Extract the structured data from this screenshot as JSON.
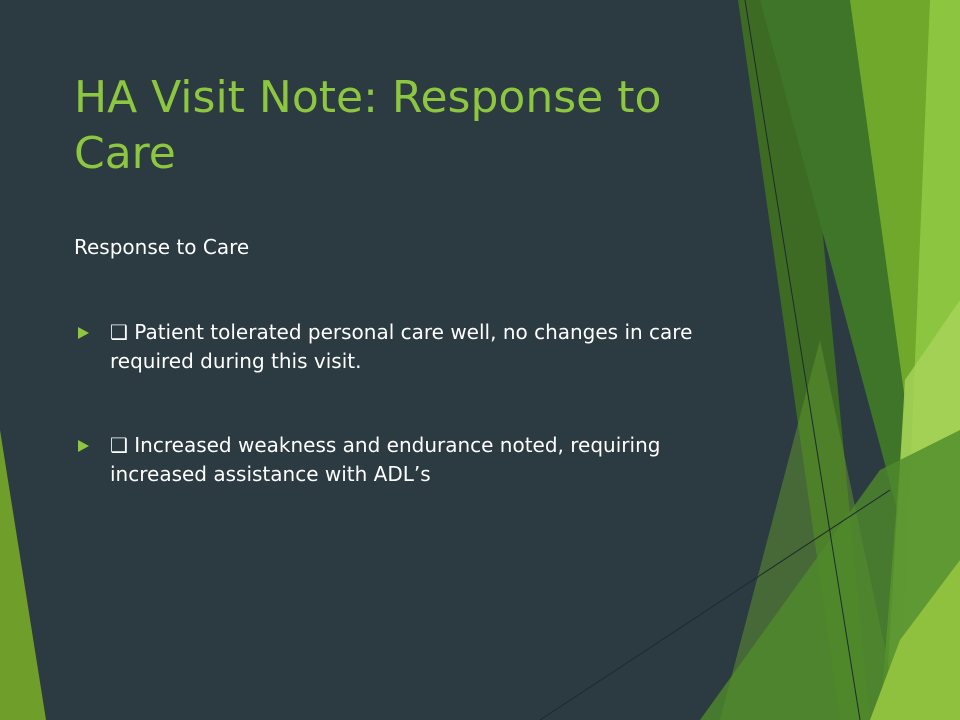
{
  "slide": {
    "title": "HA Visit Note: Response to Care",
    "subtitle": "Response to Care",
    "bullets": [
      {
        "text": "❑ Patient tolerated personal care well, no changes in care required during this visit."
      },
      {
        "text": "❑ Increased weakness and endurance noted, requiring increased assistance with ADL’s"
      }
    ]
  },
  "colors": {
    "background": "#2c3a42",
    "accent": "#8dc63f",
    "text": "#ffffff"
  }
}
